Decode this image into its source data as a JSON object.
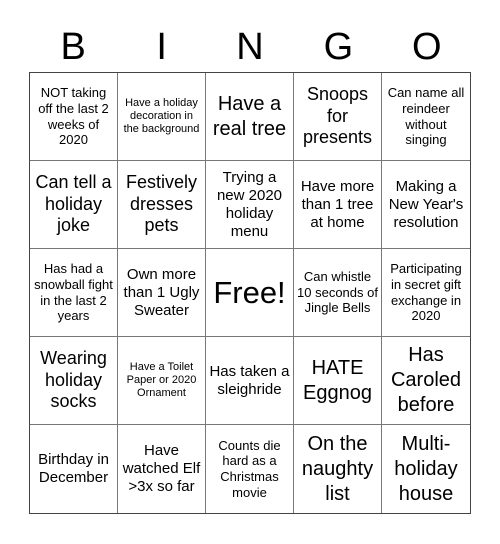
{
  "header": [
    "B",
    "I",
    "N",
    "G",
    "O"
  ],
  "cells": [
    "NOT taking off the last 2 weeks of 2020",
    "Have a holiday decoration in the background",
    "Have a real tree",
    "Snoops for presents",
    "Can name all reindeer without singing",
    "Can tell a holiday joke",
    "Festively dresses pets",
    "Trying a new 2020 holiday menu",
    "Have more than 1 tree at home",
    "Making a New Year's resolution",
    "Has had a snowball fight in the last 2 years",
    "Own more than 1 Ugly Sweater",
    "Free!",
    "Can whistle 10 seconds of Jingle Bells",
    "Participating in secret gift exchange in 2020",
    "Wearing holiday socks",
    "Have a Toilet Paper or 2020 Ornament",
    "Has taken a sleighride",
    "HATE Eggnog",
    "Has Caroled before",
    "Birthday in December",
    "Have watched Elf >3x so far",
    "Counts die hard as a Christmas movie",
    "On the naughty list",
    "Multi-holiday house"
  ]
}
